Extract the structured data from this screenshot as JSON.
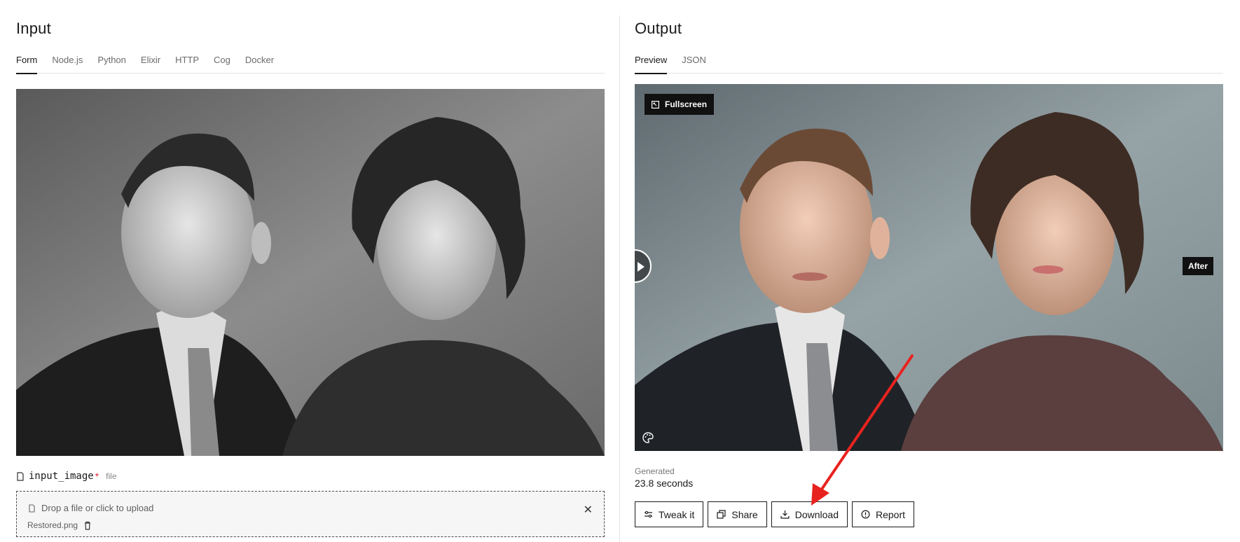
{
  "input": {
    "title": "Input",
    "tabs": [
      "Form",
      "Node.js",
      "Python",
      "Elixir",
      "HTTP",
      "Cog",
      "Docker"
    ],
    "active_tab": "Form",
    "field": {
      "name": "input_image",
      "required_mark": "*",
      "type": "file"
    },
    "dropzone": {
      "hint": "Drop a file or click to upload",
      "file_name": "Restored.png"
    }
  },
  "output": {
    "title": "Output",
    "tabs": [
      "Preview",
      "JSON"
    ],
    "active_tab": "Preview",
    "fullscreen_label": "Fullscreen",
    "after_label": "After",
    "generated_label": "Generated",
    "generated_value": "23.8 seconds",
    "actions": {
      "tweak": "Tweak it",
      "share": "Share",
      "download": "Download",
      "report": "Report"
    }
  },
  "colors": {
    "annotation_arrow": "#e8231f",
    "required": "#e0283a"
  },
  "icons": [
    "file-icon",
    "upload-icon",
    "close-icon",
    "trash-icon",
    "fullscreen-icon",
    "palette-icon",
    "tweak-icon",
    "share-icon",
    "download-icon",
    "report-icon"
  ]
}
